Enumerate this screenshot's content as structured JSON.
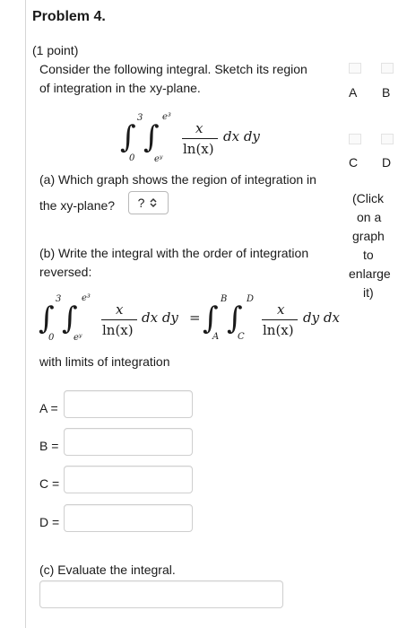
{
  "problem_title": "Problem 4.",
  "points": "(1 point)",
  "intro": {
    "line1": "Consider the following integral. Sketch its region",
    "line2": "of integration in the xy-plane."
  },
  "integral1": {
    "outer_upper": "3",
    "outer_lower": "0",
    "inner_upper": "e³",
    "inner_lower": "eʸ",
    "numerator": "x",
    "denominator": "ln(x)",
    "differentials": "dx dy"
  },
  "graph_labels": {
    "a": "A",
    "b": "B",
    "c": "C",
    "d": "D"
  },
  "enlarge_note": [
    "(Click",
    "on a",
    "graph",
    "to",
    "enlarge",
    "it)"
  ],
  "part_a": {
    "line1": "(a) Which graph shows the region of integration in",
    "line2": "the xy-plane?",
    "select_value": "?"
  },
  "part_b": {
    "line1": "(b) Write the integral with the order of integration",
    "line2": "reversed:"
  },
  "integral2": {
    "lhs_outer_upper": "3",
    "lhs_outer_lower": "0",
    "lhs_inner_upper": "e³",
    "lhs_inner_lower": "eʸ",
    "lhs_numerator": "x",
    "lhs_denominator": "ln(x)",
    "lhs_differentials": "dx dy",
    "equals": "=",
    "rhs_outer_upper": "B",
    "rhs_outer_lower": "A",
    "rhs_inner_upper": "D",
    "rhs_inner_lower": "C",
    "rhs_numerator": "x",
    "rhs_denominator": "ln(x)",
    "rhs_differentials": "dy dx"
  },
  "limits_intro": "with limits of integration",
  "limit_labels": {
    "a": "A =",
    "b": "B =",
    "c": "C =",
    "d": "D ="
  },
  "limit_values": {
    "a": "",
    "b": "",
    "c": "",
    "d": ""
  },
  "part_c": {
    "label": "(c) Evaluate the integral.",
    "value": ""
  }
}
